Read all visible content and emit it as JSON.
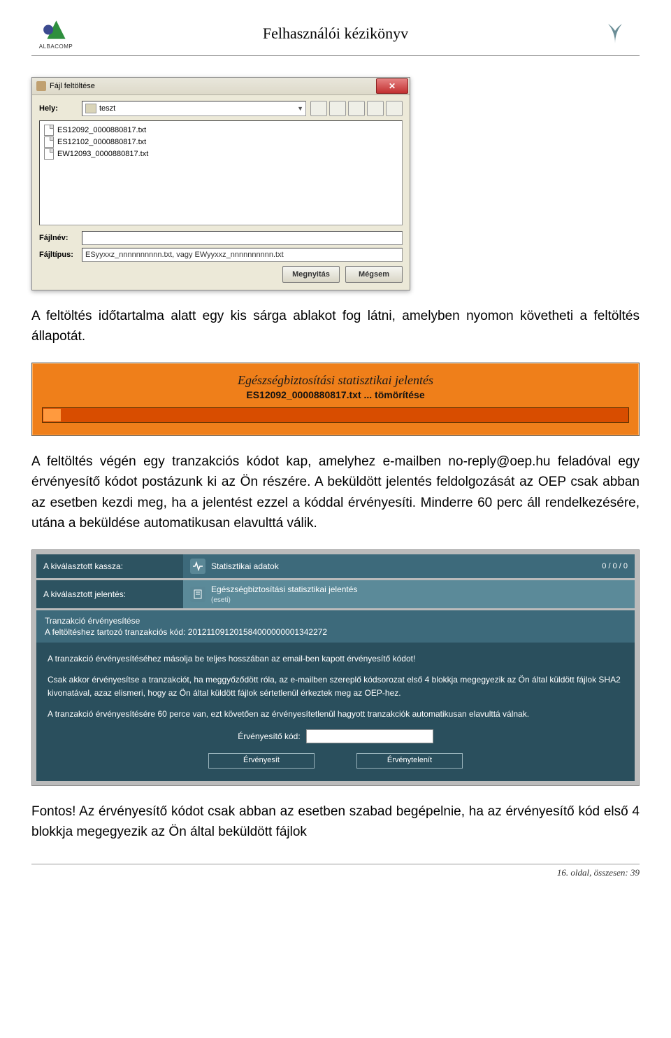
{
  "header": {
    "title": "Felhasználói kézikönyv",
    "logo_left_text": "ALBACOMP"
  },
  "file_dialog": {
    "title": "Fájl feltöltése",
    "location_label": "Hely:",
    "location_value": "teszt",
    "files": [
      "ES12092_0000880817.txt",
      "ES12102_0000880817.txt",
      "EW12093_0000880817.txt"
    ],
    "filename_label": "Fájlnév:",
    "filename_value": "",
    "filetype_label": "Fájltípus:",
    "filetype_value": "ESyyxxz_nnnnnnnnnn.txt, vagy EWyyxxz_nnnnnnnnnn.txt",
    "open_btn": "Megnyitás",
    "cancel_btn": "Mégsem"
  },
  "paragraphs": {
    "p1": "A feltöltés időtartalma alatt egy kis sárga ablakot fog látni, amelyben nyomon követheti a feltöltés állapotát.",
    "p2": "A feltöltés végén egy tranzakciós kódot kap, amelyhez e-mailben no-reply@oep.hu feladóval egy érvényesítő kódot postázunk ki az Ön részére. A beküldött jelentés feldolgozását az OEP csak abban az esetben kezdi meg, ha a jelentést ezzel a kóddal érvényesíti. Minderre 60 perc áll rendelkezésére, utána a beküldése automatikusan elavulttá válik.",
    "p3": "Fontos! Az érvényesítő kódot csak abban az esetben szabad begépelnie, ha az érvényesítő kód első 4 blokkja megegyezik az Ön által beküldött fájlok"
  },
  "progress": {
    "title": "Egészségbiztosítási statisztikai jelentés",
    "subtitle": "ES12092_0000880817.txt ... tömörítése"
  },
  "validation": {
    "kassza_label": "A kiválasztott kassza:",
    "stat_tab": "Statisztikai adatok",
    "stat_count": "0 / 0 / 0",
    "jelentes_label": "A kiválasztott jelentés:",
    "jelentes_title": "Egészségbiztosítási statisztikai jelentés",
    "jelentes_sub": "(eseti)",
    "trans_title": "Tranzakció érvényesítése",
    "trans_code_line": "A feltöltéshez tartozó tranzakciós kód: 201211091201584000000001342272",
    "dark1": "A tranzakció érvényesítéséhez másolja be teljes hosszában az email-ben kapott érvényesítő kódot!",
    "dark2": "Csak akkor érvényesítse a tranzakciót, ha meggyőződött róla, az e-mailben szereplő kódsorozat első 4 blokkja megegyezik az Ön által küldött fájlok SHA2 kivonatával, azaz elismeri, hogy az Ön által küldött fájlok sértetlenül érkeztek meg az OEP-hez.",
    "dark3": "A tranzakció érvényesítésére 60 perce van, ezt követően az érvényesítetlenül hagyott tranzakciók automatikusan elavulttá válnak.",
    "code_label": "Érvényesítő kód:",
    "btn_validate": "Érvényesít",
    "btn_invalidate": "Érvénytelenít"
  },
  "footer": {
    "page_text": "16. oldal, összesen: 39"
  }
}
